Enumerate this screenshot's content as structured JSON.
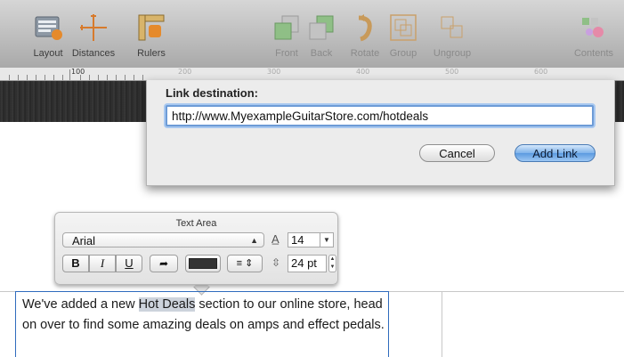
{
  "toolbar": {
    "items": [
      {
        "label": "Layout",
        "icon": "layout-icon",
        "enabled": true
      },
      {
        "label": "Distances",
        "icon": "distances-icon",
        "enabled": true
      },
      {
        "label": "Rulers",
        "icon": "rulers-icon",
        "enabled": true
      },
      {
        "label": "Front",
        "icon": "front-icon",
        "enabled": false
      },
      {
        "label": "Back",
        "icon": "back-icon",
        "enabled": false
      },
      {
        "label": "Rotate",
        "icon": "rotate-icon",
        "enabled": false
      },
      {
        "label": "Group",
        "icon": "group-icon",
        "enabled": false
      },
      {
        "label": "Ungroup",
        "icon": "ungroup-icon",
        "enabled": false
      },
      {
        "label": "Contents",
        "icon": "contents-icon",
        "enabled": false
      }
    ]
  },
  "ruler": {
    "marks": [
      "100",
      "200",
      "300",
      "400",
      "500",
      "600",
      "700"
    ]
  },
  "link_dialog": {
    "title": "Link destination:",
    "url": "http://www.MyexampleGuitarStore.com/hotdeals",
    "cancel_label": "Cancel",
    "add_label": "Add Link"
  },
  "inspector": {
    "title": "Text Area",
    "font": "Arial",
    "font_size": "14",
    "bold_label": "B",
    "italic_label": "I",
    "underline_label": "U",
    "line_height": "24 pt",
    "text_color": "#333333"
  },
  "document": {
    "text_before": "We've added a new ",
    "highlight": "Hot Deals",
    "text_after": " section to our online store, head on over to find some amazing deals on amps and effect pedals."
  },
  "colors": {
    "accent": "#5b9ae0",
    "selection": "#2f6bbd"
  }
}
